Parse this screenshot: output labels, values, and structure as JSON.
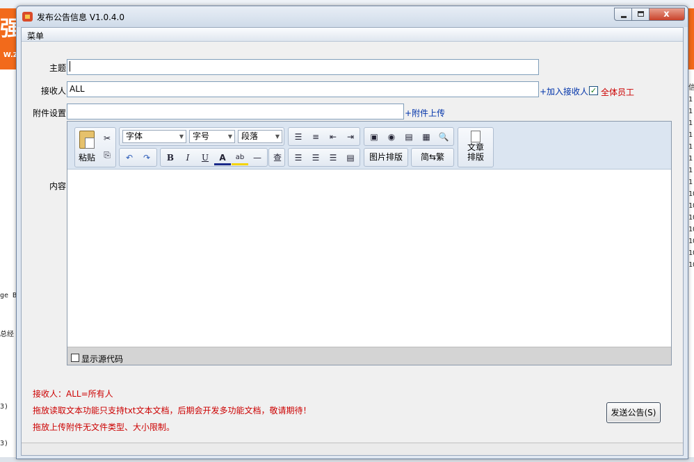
{
  "window": {
    "title": "发布公告信息 V1.0.4.0",
    "close_glyph": "x"
  },
  "menu": {
    "items": [
      "菜单"
    ]
  },
  "form": {
    "subject_label": "主题:",
    "subject_value": "",
    "recipient_label": "接收人:",
    "recipient_value": "ALL",
    "add_recipient_link": "+加入接收人",
    "all_staff_label": "全体员工",
    "all_staff_checked": true,
    "attachment_label": "附件设置:",
    "attachment_value": "",
    "upload_link": "+附件上传",
    "content_label": "内容:"
  },
  "editor": {
    "paste_label": "粘贴",
    "font_select": "字体",
    "size_select": "字号",
    "paragraph_select": "段落",
    "bold": "B",
    "italic": "I",
    "underline": "U",
    "font_color": "A",
    "highlight": "ab",
    "hr": "—",
    "find": "查",
    "image_layout": "图片排版",
    "convert_label": "简⇆繁",
    "article_layout_line1": "文章",
    "article_layout_line2": "排版",
    "show_source": "显示源代码"
  },
  "notes": [
    "接收人：ALL=所有人",
    "拖放读取文本功能只支持txt文本文档，后期会开发多功能文档，敬请期待！",
    "拖放上传附件无文件类型、大小限制。"
  ],
  "send_button": "发送公告(S)",
  "background": {
    "logo_char": "强",
    "logo_sub": "W.Z",
    "left_texts": [
      "ge B",
      "总经",
      "3)",
      "3)"
    ],
    "right_col": [
      "信",
      "1",
      "1",
      "1",
      "1",
      "1",
      "1",
      "1",
      "1",
      "10",
      "10",
      "10",
      "10",
      "10",
      "10",
      "10"
    ]
  },
  "colors": {
    "link": "#0033aa",
    "warning": "#cc0000",
    "accent_orange": "#f26a1b"
  }
}
